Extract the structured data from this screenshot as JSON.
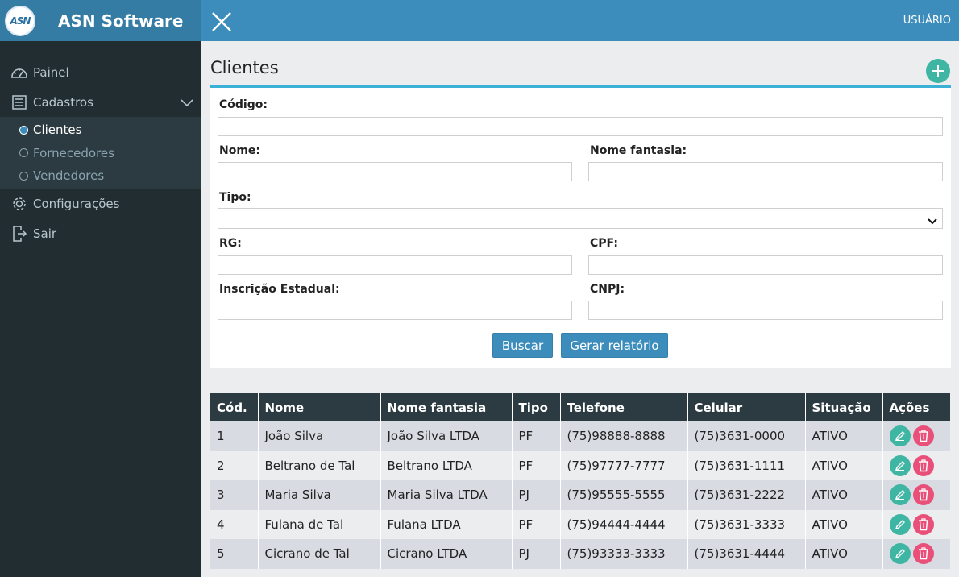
{
  "brand": {
    "logo_text": "ASN",
    "title": "ASN Software"
  },
  "topbar": {
    "user_label": "USUÁRIO"
  },
  "sidebar": {
    "items": [
      {
        "label": "Painel",
        "icon": "dashboard-icon"
      },
      {
        "label": "Cadastros",
        "icon": "list-icon"
      },
      {
        "label": "Configurações",
        "icon": "gear-icon"
      },
      {
        "label": "Sair",
        "icon": "logout-icon"
      }
    ],
    "submenu": [
      {
        "label": "Clientes",
        "active": true
      },
      {
        "label": "Fornecedores",
        "active": false
      },
      {
        "label": "Vendedores",
        "active": false
      }
    ]
  },
  "page": {
    "title": "Clientes"
  },
  "form": {
    "codigo_label": "Código:",
    "codigo_value": "",
    "nome_label": "Nome:",
    "nome_value": "",
    "fantasia_label": "Nome fantasia:",
    "fantasia_value": "",
    "tipo_label": "Tipo:",
    "tipo_value": "",
    "rg_label": "RG:",
    "rg_value": "",
    "cpf_label": "CPF:",
    "cpf_value": "",
    "ie_label": "Inscrição Estadual:",
    "ie_value": "",
    "cnpj_label": "CNPJ:",
    "cnpj_value": "",
    "search_label": "Buscar",
    "report_label": "Gerar relatório"
  },
  "table": {
    "headers": [
      "Cód.",
      "Nome",
      "Nome fantasia",
      "Tipo",
      "Telefone",
      "Celular",
      "Situação",
      "Ações"
    ],
    "rows": [
      [
        "1",
        "João Silva",
        "João Silva LTDA",
        "PF",
        "(75)98888-8888",
        "(75)3631-0000",
        "ATIVO"
      ],
      [
        "2",
        "Beltrano de Tal",
        "Beltrano LTDA",
        "PF",
        "(75)97777-7777",
        "(75)3631-1111",
        "ATIVO"
      ],
      [
        "3",
        "Maria Silva",
        "Maria Silva LTDA",
        "PJ",
        "(75)95555-5555",
        "(75)3631-2222",
        "ATIVO"
      ],
      [
        "4",
        "Fulana de Tal",
        "Fulana LTDA",
        "PF",
        "(75)94444-4444",
        "(75)3631-3333",
        "ATIVO"
      ],
      [
        "5",
        "Cicrano de Tal",
        "Cicrano LTDA",
        "PJ",
        "(75)93333-3333",
        "(75)3631-4444",
        "ATIVO"
      ]
    ]
  },
  "colors": {
    "sidebar_bg": "#222d32",
    "submenu_bg": "#2c3b41",
    "topbar_bg": "#3c8dbc",
    "brand_bg": "#357ca5",
    "accent": "#3cb1d8",
    "edit": "#3fb5a3",
    "delete": "#e8507a"
  }
}
